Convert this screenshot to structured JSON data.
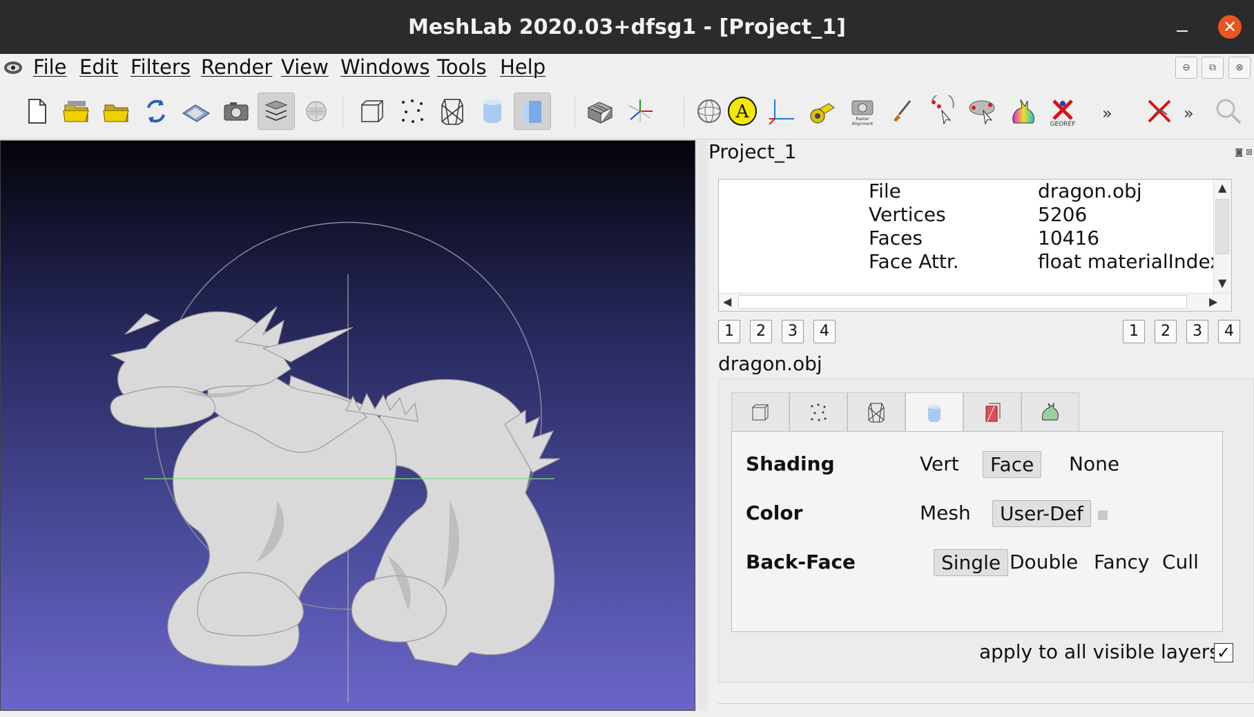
{
  "window": {
    "title": "MeshLab 2020.03+dfsg1 - [Project_1]",
    "close_glyph": "✕"
  },
  "menu": [
    "File",
    "Edit",
    "Filters",
    "Render",
    "View",
    "Windows",
    "Tools",
    "Help"
  ],
  "mdi_buttons": [
    "⊖",
    "⧉",
    "⊗"
  ],
  "toolbar": {
    "overflow_glyph": "»",
    "annotation_letter": "A",
    "raster_label_1": "Raster",
    "raster_label_2": "Alignment",
    "georef_label": "GEOREF",
    "icons": [
      "new-file",
      "open-project",
      "open-mesh",
      "reload",
      "save",
      "snapshot",
      "layers",
      "show-raster",
      "bounding-box",
      "points",
      "wireframe",
      "flat",
      "smooth",
      "grid",
      "axes",
      "trackball",
      "annotation",
      "measure",
      "tape",
      "raster-alignment",
      "paint",
      "point-picking",
      "alignment",
      "color-bunny",
      "georef",
      "disable"
    ]
  },
  "panel": {
    "title": "Project_1",
    "dock_glyphs": "◙ ⊠",
    "info": [
      {
        "key": "File",
        "value": "dragon.obj"
      },
      {
        "key": "Vertices",
        "value": "5206"
      },
      {
        "key": "Faces",
        "value": "10416"
      },
      {
        "key": "Face Attr.",
        "value": "float materialIndex"
      }
    ],
    "left_numbers": [
      "1",
      "2",
      "3",
      "4"
    ],
    "right_numbers": [
      "1",
      "2",
      "3",
      "4"
    ],
    "layer_name": "dragon.obj",
    "render_tabs": [
      "box",
      "points",
      "wire",
      "fill",
      "texture",
      "bunny"
    ],
    "shading": {
      "label": "Shading",
      "options": [
        "Vert",
        "Face",
        "None"
      ],
      "selected": "Face"
    },
    "color": {
      "label": "Color",
      "options": [
        "Mesh",
        "User-Def"
      ],
      "selected": "User-Def"
    },
    "backface": {
      "label": "Back-Face",
      "options": [
        "Single",
        "Double",
        "Fancy",
        "Cull"
      ],
      "selected": "Single"
    },
    "apply_all": {
      "label": "apply to all visible layers",
      "checked": true,
      "check_glyph": "✓"
    }
  },
  "viewport": {
    "model": "dragon",
    "bg_top": "#04040a",
    "bg_bottom": "#6a66c9"
  }
}
